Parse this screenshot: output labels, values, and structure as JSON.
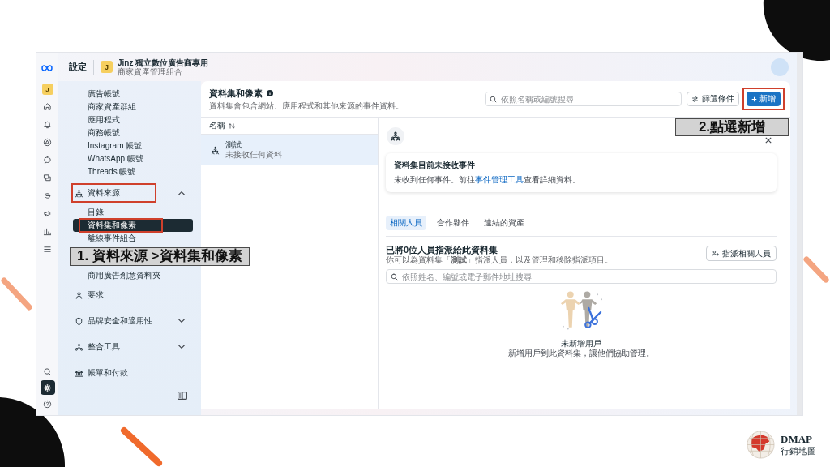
{
  "rail": {
    "account_initial": "J",
    "items": [
      {
        "selected": false
      },
      {
        "selected": false
      },
      {
        "selected": false
      },
      {
        "selected": false
      },
      {
        "selected": false
      },
      {
        "selected": false
      },
      {
        "selected": false
      },
      {
        "selected": false
      },
      {
        "selected": false
      }
    ],
    "bottom_items": [
      {
        "selected": false
      },
      {
        "selected": true
      },
      {
        "selected": false
      }
    ]
  },
  "header": {
    "title": "設定",
    "account": {
      "initial": "J",
      "name": "Jinz 獨立數位廣告商專用",
      "subtitle": "商家資產管理組合"
    }
  },
  "sidebar": {
    "links": [
      "廣告帳號",
      "商家資產群組",
      "應用程式",
      "商務帳號",
      "Instagram 帳號",
      "WhatsApp 帳號",
      "Threads 帳號"
    ],
    "sections": [
      {
        "label": "資料來源",
        "expanded": true,
        "highlighted": true,
        "children": [
          {
            "label": "目錄",
            "selected": false,
            "highlighted": false
          },
          {
            "label": "資料集和像素",
            "selected": true,
            "highlighted": true
          },
          {
            "label": "離線事件組合",
            "selected": false,
            "highlighted": false
          },
          {
            "label": "商用廣告創意資料夾",
            "selected": false,
            "highlighted": false
          }
        ]
      },
      {
        "label": "要求",
        "highlighted": false
      },
      {
        "label": "品牌安全和適用性",
        "expanded": false,
        "highlighted": false
      },
      {
        "label": "整合工具",
        "expanded": false,
        "highlighted": false
      },
      {
        "label": "帳單和付款",
        "highlighted": false
      }
    ]
  },
  "page": {
    "title": "資料集和像素",
    "subtitle": "資料集會包含網站、應用程式和其他來源的事件資料。",
    "search": {
      "placeholder": "依照名稱或編號搜尋"
    },
    "filter_button": "篩選條件",
    "add_button": {
      "label": "新增",
      "highlighted": true
    }
  },
  "list": {
    "column": "名稱",
    "rows": [
      {
        "name": "測試",
        "status": "未接收任何資料",
        "selected": true
      }
    ]
  },
  "detail": {
    "notice": {
      "title": "資料集目前未接收事件",
      "text_before": "未收到任何事件。前往",
      "link": "事件管理工具",
      "text_after": "查看詳細資料。"
    },
    "tabs": [
      {
        "label": "相關人員",
        "selected": true
      },
      {
        "label": "合作夥伴",
        "selected": false
      },
      {
        "label": "連結的資產",
        "selected": false
      }
    ],
    "people": {
      "title": "已將0位人員指派給此資料集",
      "description": "你可以為資料集「**測試**」指派人員，以及管理和移除指派項目。",
      "assign_button": "指派相關人員",
      "search": {
        "placeholder": "依照姓名、編號或電子郵件地址搜尋"
      },
      "empty_title": "未新增用戶",
      "empty_text": "新增用戶到此資料集，讓他們協助管理。"
    }
  },
  "annotations": [
    {
      "text": "1. 資料來源 >資料集和像素"
    },
    {
      "text": "2.點選新增"
    }
  ],
  "slide": {
    "logo": {
      "title": "DMAP",
      "subtitle": "行銷地圖"
    }
  }
}
